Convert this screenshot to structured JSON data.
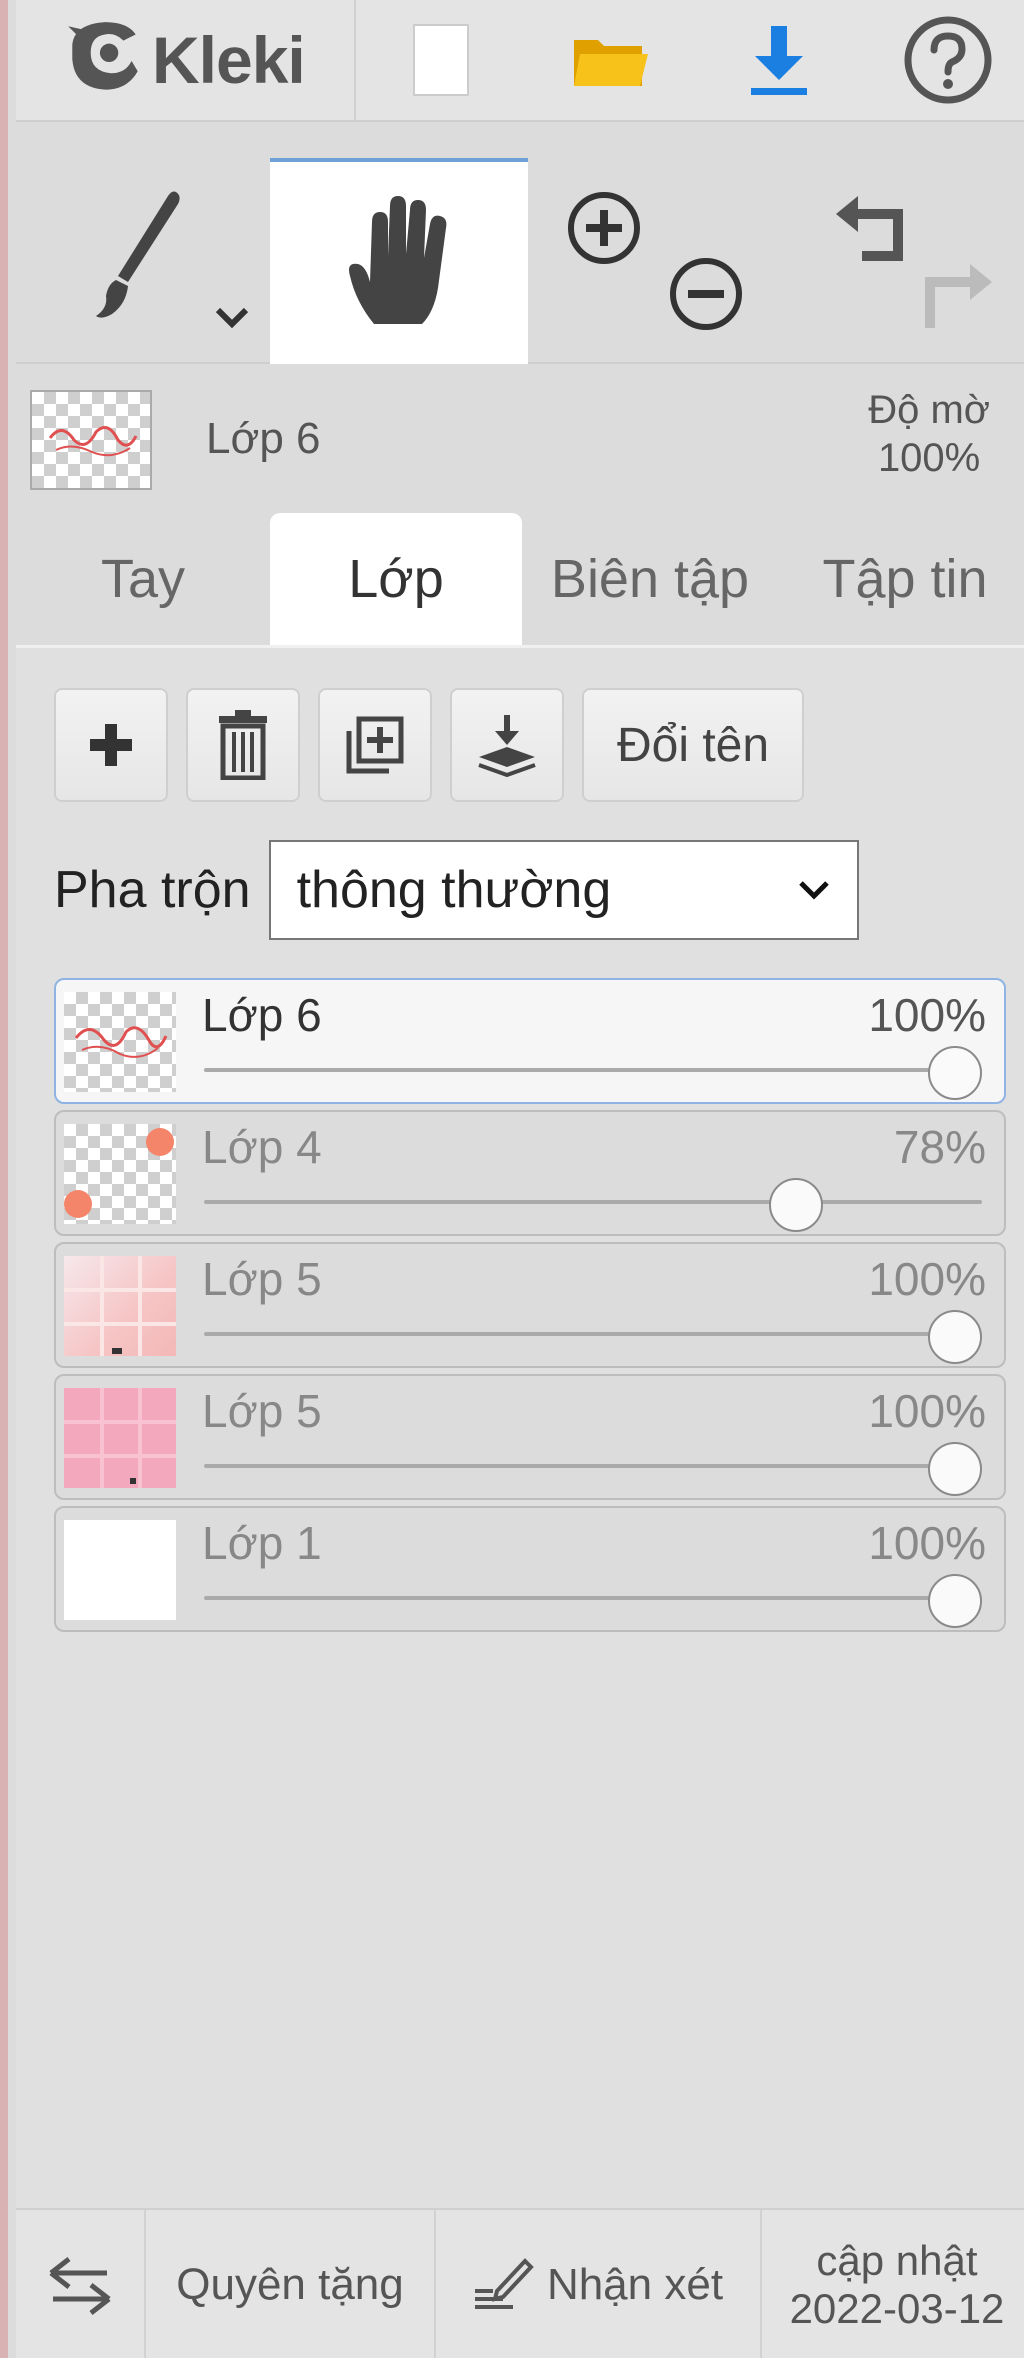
{
  "app": {
    "name": "Kleki"
  },
  "topbar": {
    "icons": [
      "new-document-icon",
      "open-folder-icon",
      "download-icon",
      "help-icon"
    ]
  },
  "tools": {
    "brush": "brush-icon",
    "hand": "hand-icon",
    "zoom_in": "zoom-in-icon",
    "zoom_out": "zoom-out-icon",
    "undo": "undo-icon",
    "redo": "redo-icon"
  },
  "current_layer": {
    "name": "Lớp 6",
    "opacity_label": "Độ mờ",
    "opacity_value": "100%"
  },
  "tabs": [
    {
      "label": "Tay",
      "active": false
    },
    {
      "label": "Lớp",
      "active": true
    },
    {
      "label": "Biên tập",
      "active": false
    },
    {
      "label": "Tập tin",
      "active": false
    }
  ],
  "layer_actions": {
    "add": "plus-icon",
    "delete": "trash-icon",
    "duplicate": "duplicate-icon",
    "merge_down": "merge-down-icon",
    "rename_label": "Đổi tên"
  },
  "blend": {
    "label": "Pha trộn",
    "value": "thông thường"
  },
  "layers": [
    {
      "name": "Lớp 6",
      "opacity": "100%",
      "level": 1.0,
      "selected": true
    },
    {
      "name": "Lớp 4",
      "opacity": "78%",
      "level": 0.78,
      "selected": false
    },
    {
      "name": "Lớp 5",
      "opacity": "100%",
      "level": 1.0,
      "selected": false
    },
    {
      "name": "Lớp 5",
      "opacity": "100%",
      "level": 1.0,
      "selected": false
    },
    {
      "name": "Lớp 1",
      "opacity": "100%",
      "level": 1.0,
      "selected": false
    }
  ],
  "footer": {
    "swap_icon": "swap-arrows-icon",
    "donate": "Quyên tặng",
    "feedback": "Nhận xét",
    "update_label": "cập nhật",
    "update_date": "2022-03-12"
  },
  "colors": {
    "accent_blue": "#1a7fe0",
    "folder_yellow": "#f5b800",
    "selected_border": "#8fb4e3"
  }
}
